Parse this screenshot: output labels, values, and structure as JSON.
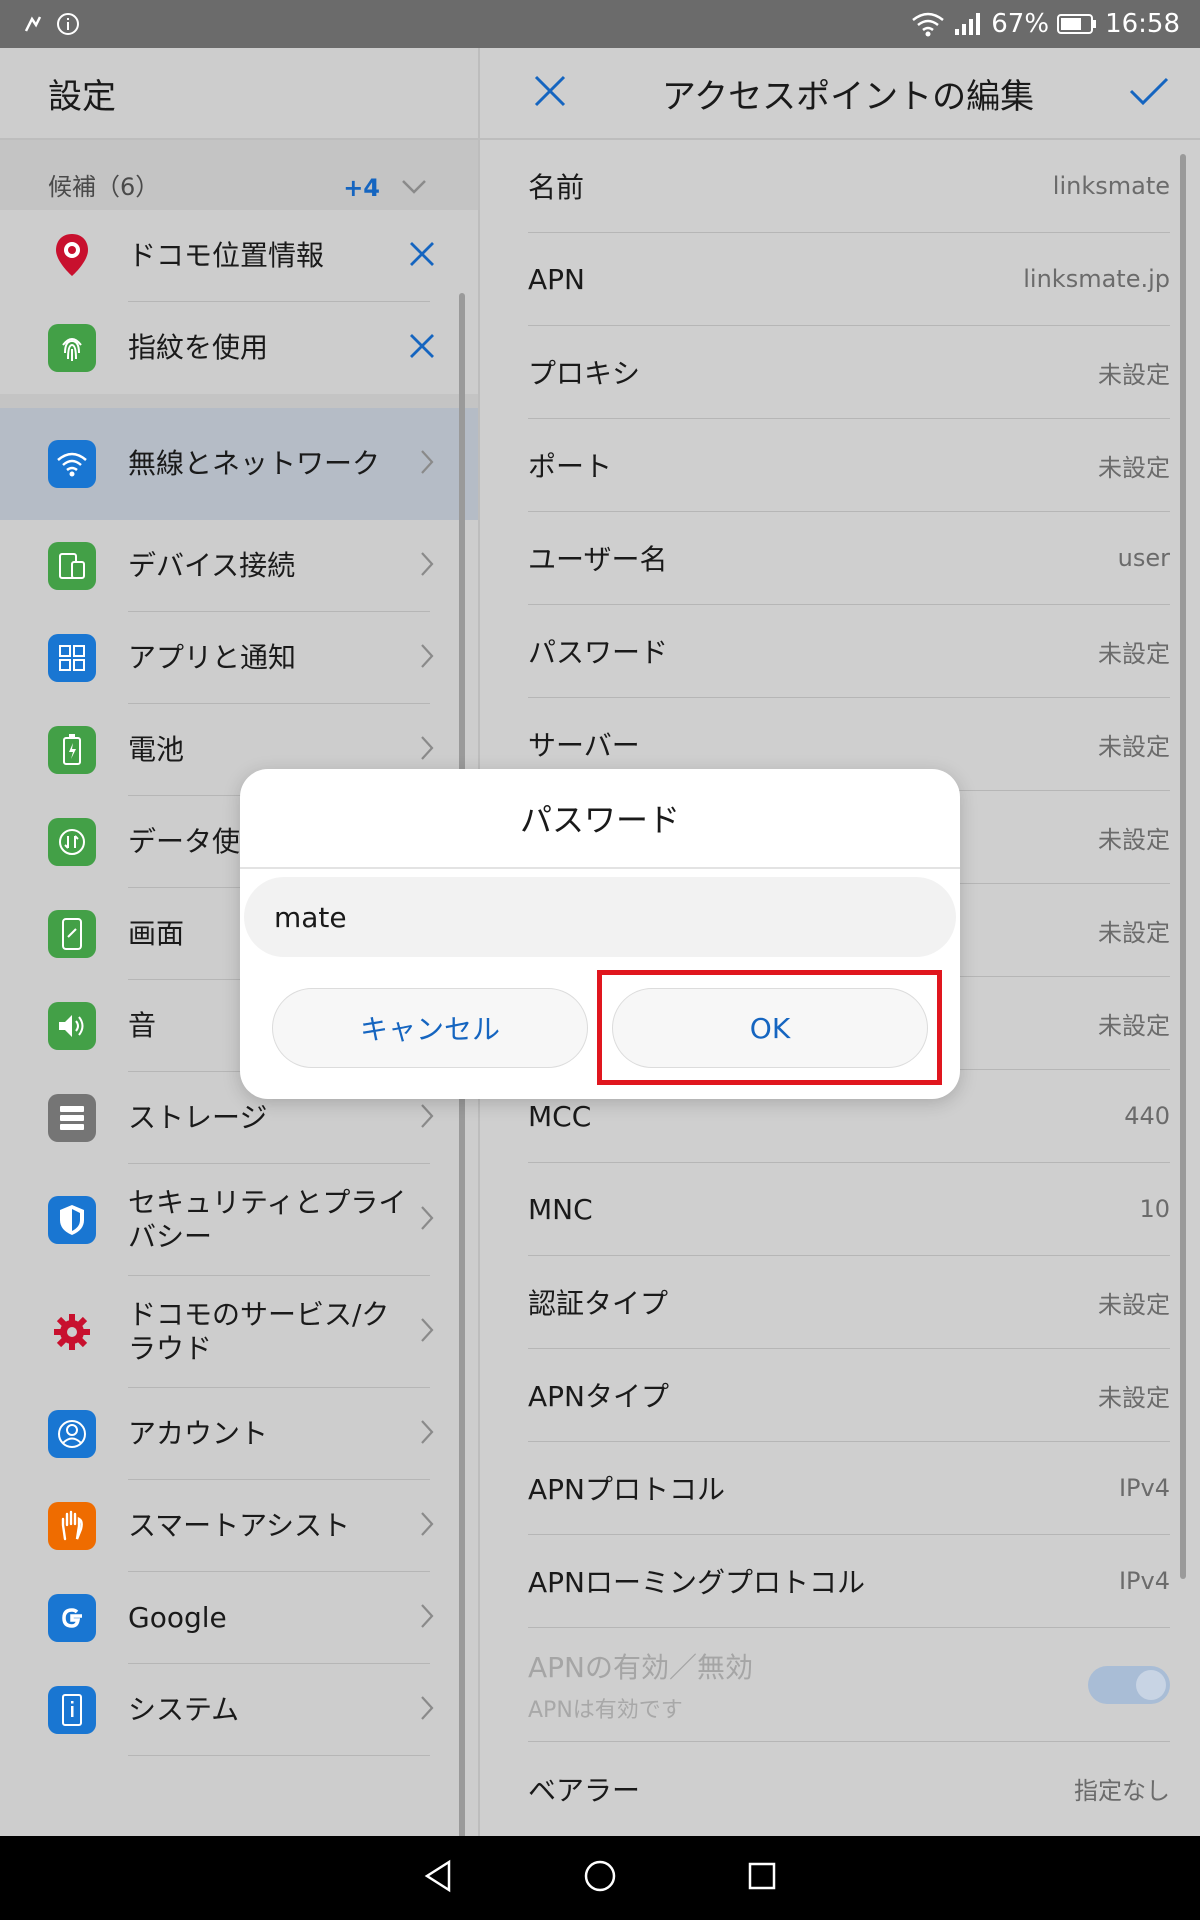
{
  "statusbar": {
    "battery": "67%",
    "time": "16:58"
  },
  "left": {
    "title": "設定",
    "suggestions": {
      "label": "候補（6）",
      "more": "+4"
    },
    "suggestion_items": [
      {
        "label": "ドコモ位置情報",
        "icon": "docomo-location-icon",
        "color": "#c8102e"
      },
      {
        "label": "指紋を使用",
        "icon": "fingerprint-icon",
        "color": "#43a047"
      }
    ],
    "items": [
      {
        "label": "無線とネットワーク",
        "icon": "wifi-icon",
        "color": "#1976d2"
      },
      {
        "label": "デバイス接続",
        "icon": "device-connection-icon",
        "color": "#43a047"
      },
      {
        "label": "アプリと通知",
        "icon": "apps-grid-icon",
        "color": "#1976d2"
      },
      {
        "label": "電池",
        "icon": "battery-icon",
        "color": "#43a047"
      },
      {
        "label": "データ使",
        "icon": "data-usage-icon",
        "color": "#43a047"
      },
      {
        "label": "画面",
        "icon": "display-icon",
        "color": "#43a047"
      },
      {
        "label": "音",
        "icon": "sound-icon",
        "color": "#43a047"
      },
      {
        "label": "ストレージ",
        "icon": "storage-icon",
        "color": "#757575"
      },
      {
        "label": "セキュリティとプライバシー",
        "icon": "shield-icon",
        "color": "#1976d2"
      },
      {
        "label": "ドコモのサービス/クラウド",
        "icon": "docomo-gear-icon",
        "color": "#c8102e"
      },
      {
        "label": "アカウント",
        "icon": "account-icon",
        "color": "#1976d2"
      },
      {
        "label": "スマートアシスト",
        "icon": "hand-icon",
        "color": "#ef6c00"
      },
      {
        "label": "Google",
        "icon": "google-icon",
        "color": "#1976d2"
      },
      {
        "label": "システム",
        "icon": "system-info-icon",
        "color": "#1976d2"
      }
    ]
  },
  "right": {
    "title": "アクセスポイントの編集",
    "fields": [
      {
        "key": "名前",
        "value": "linksmate"
      },
      {
        "key": "APN",
        "value": "linksmate.jp"
      },
      {
        "key": "プロキシ",
        "value": "未設定"
      },
      {
        "key": "ポート",
        "value": "未設定"
      },
      {
        "key": "ユーザー名",
        "value": "user"
      },
      {
        "key": "パスワード",
        "value": "未設定"
      },
      {
        "key": "サーバー",
        "value": "未設定"
      },
      {
        "key": "",
        "value": "未設定"
      },
      {
        "key": "",
        "value": "未設定"
      },
      {
        "key": "",
        "value": "未設定"
      },
      {
        "key": "MCC",
        "value": "440"
      },
      {
        "key": "MNC",
        "value": "10"
      },
      {
        "key": "認証タイプ",
        "value": "未設定"
      },
      {
        "key": "APNタイプ",
        "value": "未設定"
      },
      {
        "key": "APNプロトコル",
        "value": "IPv4"
      },
      {
        "key": "APNローミングプロトコル",
        "value": "IPv4"
      }
    ],
    "toggle": {
      "key": "APNの有効／無効",
      "sub": "APNは有効です",
      "enabled": true
    },
    "bearer": {
      "key": "ベアラー",
      "value": "指定なし"
    }
  },
  "dialog": {
    "title": "パスワード",
    "input_value": "mate",
    "cancel_label": "キャンセル",
    "ok_label": "OK"
  }
}
